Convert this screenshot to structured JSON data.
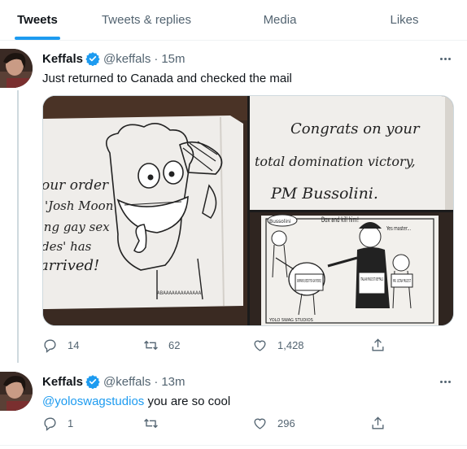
{
  "tabs": [
    {
      "label": "Tweets",
      "active": true
    },
    {
      "label": "Tweets & replies",
      "active": false
    },
    {
      "label": "Media",
      "active": false
    },
    {
      "label": "Likes",
      "active": false
    }
  ],
  "colors": {
    "accent": "#1d9bf0",
    "text": "#0f1419",
    "muted": "#536471",
    "border": "#eff3f4"
  },
  "tweets": [
    {
      "name": "Keffals",
      "handle": "@keffals",
      "separator": "·",
      "time": "15m",
      "text": "Just returned to Canada and checked the mail",
      "media": {
        "photo1": {
          "lines": [
            "our order",
            "'Josh Moon",
            "ing gay sex",
            "des' has",
            "arrived!"
          ],
          "footer": "ABAAAAAAAAAAAAA"
        },
        "photo2": {
          "lines": [
            "Congrats on your",
            "total domination victory,",
            "PM Bussolini."
          ]
        },
        "photo3": {
          "bubble1": "Bussolini",
          "bubble2": "Dox and kill him!",
          "bubble3": "Yes master...",
          "kiwi_sign": "KIWIFARMS (REDDIT FOR GAY PEOPLE)",
          "fascist_sign": "ITALIAN FASCIST KEFFALS",
          "ultra_sign": "MR. ULTRA FASCIST",
          "credit": "YOLO SWAG STUDIOS"
        }
      },
      "stats": {
        "replies": "14",
        "retweets": "62",
        "likes": "1,428"
      }
    },
    {
      "name": "Keffals",
      "handle": "@keffals",
      "separator": "·",
      "time": "13m",
      "mention": "@yoloswagstudios",
      "text_rest": " you are so cool",
      "stats": {
        "replies": "1",
        "retweets": "",
        "likes": "296"
      }
    }
  ],
  "icons": {
    "verified": "verified-badge-icon",
    "reply": "reply-bubble-icon",
    "retweet": "retweet-icon",
    "like": "heart-icon",
    "share": "share-icon",
    "more": "more-dots-icon"
  }
}
